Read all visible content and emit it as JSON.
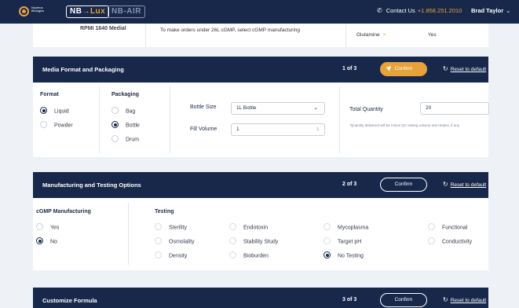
{
  "header": {
    "logo_text": "Nucleus Biologics",
    "brand_lux_prefix": "NB",
    "brand_lux_arrow": "→",
    "brand_lux_suffix": "Lux",
    "brand_air": "NB-AIR",
    "contact_label": "Contact Us",
    "contact_phone": "+1.858.251.2010",
    "user_name": "Brad Taylor",
    "phone_icon": "phone-icon",
    "chevron_icon": "chevron-down-icon"
  },
  "previous": {
    "media_name": "RPMI 1640 Medial",
    "note": "To make orders under 26L cGMP, select cGMP manufacturing",
    "glutamine_label": "Glutamine",
    "glutamine_arrow": ">",
    "glutamine_value": "Yes"
  },
  "media_format": {
    "title": "Media Format and Packaging",
    "step": "1 of 3",
    "confirm_label": "Confirm",
    "reset_label": "Reset to default",
    "format_title": "Format",
    "format_options": [
      "Liquid",
      "Powder"
    ],
    "format_selected": "Liquid",
    "packaging_title": "Packaging",
    "packaging_options": [
      "Bag",
      "Bottle",
      "Drum"
    ],
    "packaging_selected": "Bottle",
    "bottle_size_label": "Bottle Size",
    "bottle_size_value": "1L Bottle",
    "fill_volume_label": "Fill Volume",
    "fill_volume_value": "1",
    "fill_volume_unit": "L",
    "total_quantity_label": "Total Quantity",
    "total_quantity_value": "20",
    "quantity_note": "*Quantity delivered will be minus QC testing volume and retains, if any"
  },
  "manufacturing": {
    "title": "Manufacturing and Testing Options",
    "step": "2 of 3",
    "confirm_label": "Confirm",
    "reset_label": "Reset to default",
    "cgmp_title": "cGMP Manufacturing",
    "cgmp_options": [
      "Yes",
      "No"
    ],
    "cgmp_selected": "No",
    "testing_title": "Testing",
    "testing_col1": [
      "Sterility",
      "Osmolality",
      "Density"
    ],
    "testing_col2": [
      "Endotoxin",
      "Stability Study",
      "Bioburden"
    ],
    "testing_col3": [
      "Mycoplasma",
      "Target pH",
      "No Testing"
    ],
    "testing_col4": [
      "Functional",
      "Conductivity"
    ],
    "testing_selected": "No Testing"
  },
  "customize": {
    "title": "Customize Formula",
    "step": "3 of 3",
    "confirm_label": "Confirm",
    "reset_label": "Reset to default"
  },
  "colors": {
    "navy": "#17284b",
    "accent": "#e8a23a",
    "background": "#eef1f5"
  }
}
